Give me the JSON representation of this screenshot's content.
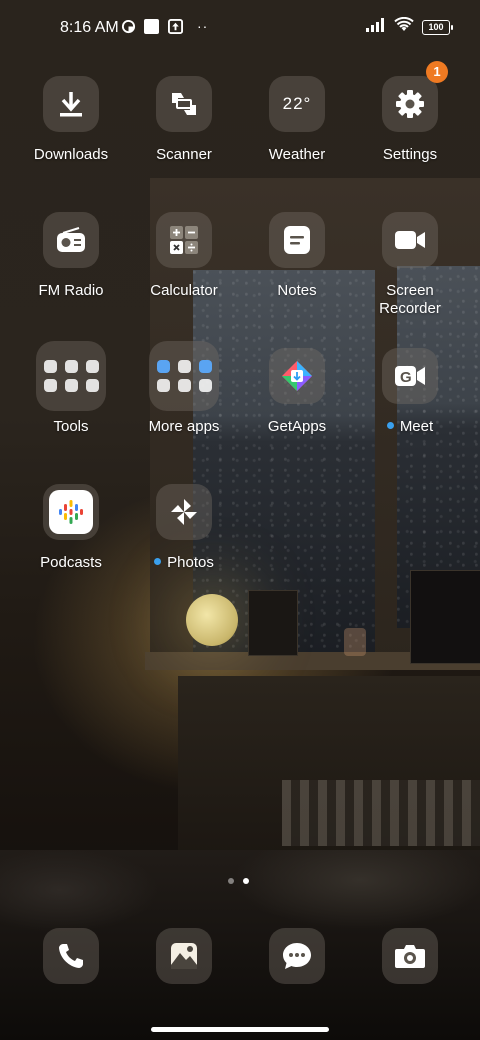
{
  "status_bar": {
    "time": "8:16 AM",
    "battery": "100",
    "more": "··"
  },
  "apps": {
    "downloads": {
      "label": "Downloads"
    },
    "scanner": {
      "label": "Scanner"
    },
    "weather": {
      "label": "Weather",
      "temp": "22°"
    },
    "settings": {
      "label": "Settings",
      "badge": "1"
    },
    "fm_radio": {
      "label": "FM Radio"
    },
    "calculator": {
      "label": "Calculator"
    },
    "notes": {
      "label": "Notes"
    },
    "screen_recorder": {
      "label": "Screen Recorder"
    },
    "tools": {
      "label": "Tools"
    },
    "more_apps": {
      "label": "More apps"
    },
    "getapps": {
      "label": "GetApps"
    },
    "meet": {
      "label": "Meet"
    },
    "podcasts": {
      "label": "Podcasts"
    },
    "photos": {
      "label": "Photos"
    }
  },
  "dock": {
    "items": [
      "phone-icon",
      "gallery-icon",
      "messages-icon",
      "camera-icon"
    ]
  },
  "pager": {
    "pages": 2,
    "current": 2
  },
  "colors": {
    "badge": "#ef7a22",
    "new_dot": "#3aa0ee",
    "icon_tile": "rgba(120,114,106,0.38)"
  }
}
